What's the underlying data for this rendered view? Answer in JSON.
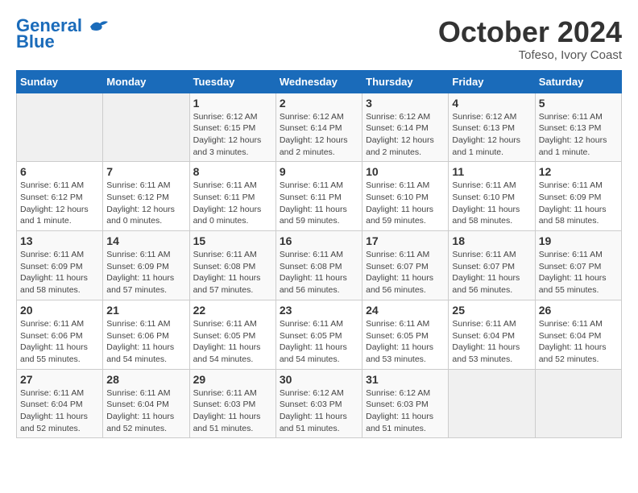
{
  "header": {
    "logo_line1": "General",
    "logo_line2": "Blue",
    "month": "October 2024",
    "location": "Tofeso, Ivory Coast"
  },
  "weekdays": [
    "Sunday",
    "Monday",
    "Tuesday",
    "Wednesday",
    "Thursday",
    "Friday",
    "Saturday"
  ],
  "weeks": [
    [
      {
        "day": "",
        "info": ""
      },
      {
        "day": "",
        "info": ""
      },
      {
        "day": "1",
        "info": "Sunrise: 6:12 AM\nSunset: 6:15 PM\nDaylight: 12 hours and 3 minutes."
      },
      {
        "day": "2",
        "info": "Sunrise: 6:12 AM\nSunset: 6:14 PM\nDaylight: 12 hours and 2 minutes."
      },
      {
        "day": "3",
        "info": "Sunrise: 6:12 AM\nSunset: 6:14 PM\nDaylight: 12 hours and 2 minutes."
      },
      {
        "day": "4",
        "info": "Sunrise: 6:12 AM\nSunset: 6:13 PM\nDaylight: 12 hours and 1 minute."
      },
      {
        "day": "5",
        "info": "Sunrise: 6:11 AM\nSunset: 6:13 PM\nDaylight: 12 hours and 1 minute."
      }
    ],
    [
      {
        "day": "6",
        "info": "Sunrise: 6:11 AM\nSunset: 6:12 PM\nDaylight: 12 hours and 1 minute."
      },
      {
        "day": "7",
        "info": "Sunrise: 6:11 AM\nSunset: 6:12 PM\nDaylight: 12 hours and 0 minutes."
      },
      {
        "day": "8",
        "info": "Sunrise: 6:11 AM\nSunset: 6:11 PM\nDaylight: 12 hours and 0 minutes."
      },
      {
        "day": "9",
        "info": "Sunrise: 6:11 AM\nSunset: 6:11 PM\nDaylight: 11 hours and 59 minutes."
      },
      {
        "day": "10",
        "info": "Sunrise: 6:11 AM\nSunset: 6:10 PM\nDaylight: 11 hours and 59 minutes."
      },
      {
        "day": "11",
        "info": "Sunrise: 6:11 AM\nSunset: 6:10 PM\nDaylight: 11 hours and 58 minutes."
      },
      {
        "day": "12",
        "info": "Sunrise: 6:11 AM\nSunset: 6:09 PM\nDaylight: 11 hours and 58 minutes."
      }
    ],
    [
      {
        "day": "13",
        "info": "Sunrise: 6:11 AM\nSunset: 6:09 PM\nDaylight: 11 hours and 58 minutes."
      },
      {
        "day": "14",
        "info": "Sunrise: 6:11 AM\nSunset: 6:09 PM\nDaylight: 11 hours and 57 minutes."
      },
      {
        "day": "15",
        "info": "Sunrise: 6:11 AM\nSunset: 6:08 PM\nDaylight: 11 hours and 57 minutes."
      },
      {
        "day": "16",
        "info": "Sunrise: 6:11 AM\nSunset: 6:08 PM\nDaylight: 11 hours and 56 minutes."
      },
      {
        "day": "17",
        "info": "Sunrise: 6:11 AM\nSunset: 6:07 PM\nDaylight: 11 hours and 56 minutes."
      },
      {
        "day": "18",
        "info": "Sunrise: 6:11 AM\nSunset: 6:07 PM\nDaylight: 11 hours and 56 minutes."
      },
      {
        "day": "19",
        "info": "Sunrise: 6:11 AM\nSunset: 6:07 PM\nDaylight: 11 hours and 55 minutes."
      }
    ],
    [
      {
        "day": "20",
        "info": "Sunrise: 6:11 AM\nSunset: 6:06 PM\nDaylight: 11 hours and 55 minutes."
      },
      {
        "day": "21",
        "info": "Sunrise: 6:11 AM\nSunset: 6:06 PM\nDaylight: 11 hours and 54 minutes."
      },
      {
        "day": "22",
        "info": "Sunrise: 6:11 AM\nSunset: 6:05 PM\nDaylight: 11 hours and 54 minutes."
      },
      {
        "day": "23",
        "info": "Sunrise: 6:11 AM\nSunset: 6:05 PM\nDaylight: 11 hours and 54 minutes."
      },
      {
        "day": "24",
        "info": "Sunrise: 6:11 AM\nSunset: 6:05 PM\nDaylight: 11 hours and 53 minutes."
      },
      {
        "day": "25",
        "info": "Sunrise: 6:11 AM\nSunset: 6:04 PM\nDaylight: 11 hours and 53 minutes."
      },
      {
        "day": "26",
        "info": "Sunrise: 6:11 AM\nSunset: 6:04 PM\nDaylight: 11 hours and 52 minutes."
      }
    ],
    [
      {
        "day": "27",
        "info": "Sunrise: 6:11 AM\nSunset: 6:04 PM\nDaylight: 11 hours and 52 minutes."
      },
      {
        "day": "28",
        "info": "Sunrise: 6:11 AM\nSunset: 6:04 PM\nDaylight: 11 hours and 52 minutes."
      },
      {
        "day": "29",
        "info": "Sunrise: 6:11 AM\nSunset: 6:03 PM\nDaylight: 11 hours and 51 minutes."
      },
      {
        "day": "30",
        "info": "Sunrise: 6:12 AM\nSunset: 6:03 PM\nDaylight: 11 hours and 51 minutes."
      },
      {
        "day": "31",
        "info": "Sunrise: 6:12 AM\nSunset: 6:03 PM\nDaylight: 11 hours and 51 minutes."
      },
      {
        "day": "",
        "info": ""
      },
      {
        "day": "",
        "info": ""
      }
    ]
  ]
}
